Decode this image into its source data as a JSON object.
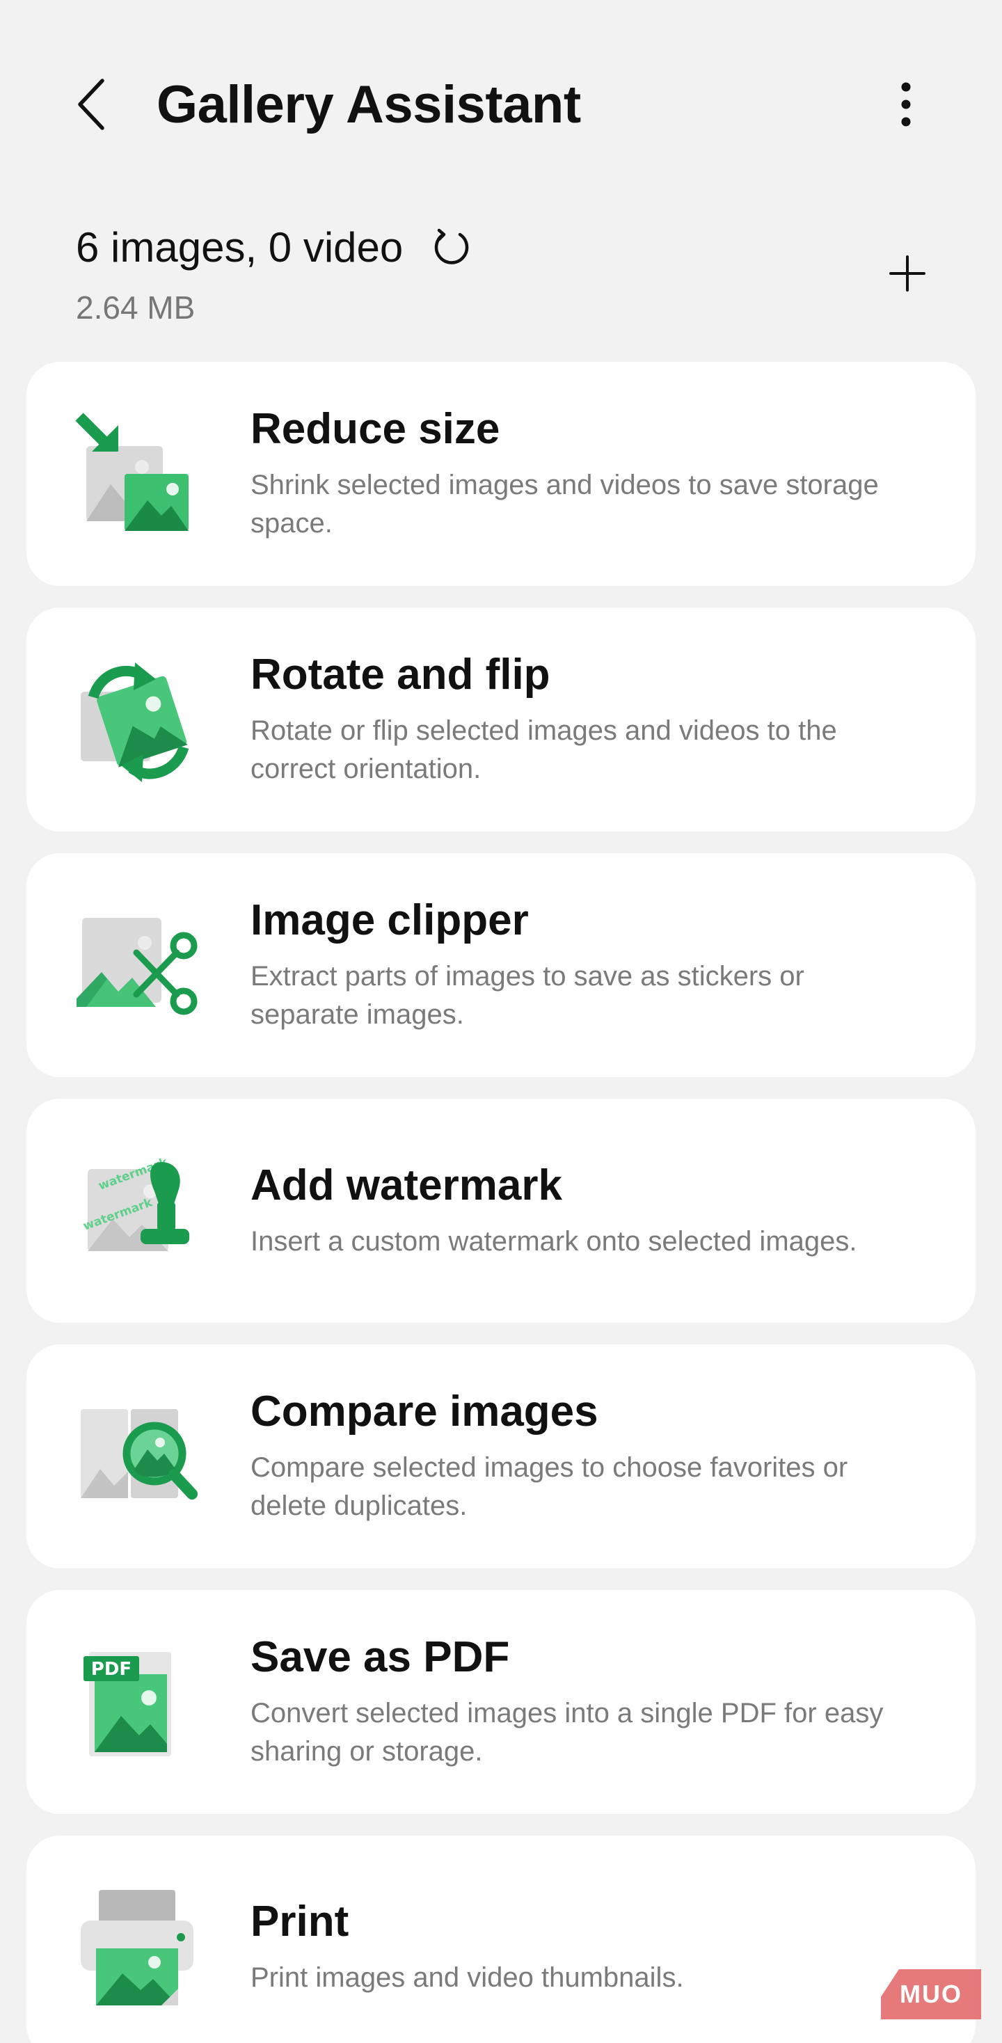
{
  "header": {
    "title": "Gallery Assistant",
    "back_icon": "chevron-left-icon",
    "more_icon": "more-vertical-icon"
  },
  "summary": {
    "count": "6 images, 0 video",
    "size": "2.64 MB",
    "refresh_icon": "refresh-icon",
    "add_icon": "plus-icon"
  },
  "colors": {
    "background": "#f2f2f2",
    "card": "#ffffff",
    "accent_green": "#1f9d55",
    "light_green": "#5fd08a",
    "muted_text": "#7a7a7a"
  },
  "tools": [
    {
      "title": "Reduce size",
      "description": "Shrink selected images and videos to save storage space.",
      "icon": "reduce-size-icon"
    },
    {
      "title": "Rotate and flip",
      "description": "Rotate or flip selected images and videos to the correct orientation.",
      "icon": "rotate-flip-icon"
    },
    {
      "title": "Image clipper",
      "description": "Extract parts of images to save as stickers or separate images.",
      "icon": "scissors-icon"
    },
    {
      "title": "Add watermark",
      "description": "Insert a custom watermark onto selected images.",
      "icon": "stamp-icon",
      "icon_text": "watermark"
    },
    {
      "title": "Compare images",
      "description": "Compare selected images to choose favorites or delete duplicates.",
      "icon": "magnifier-icon"
    },
    {
      "title": "Save as PDF",
      "description": "Convert selected images into a single PDF for easy sharing or storage.",
      "icon": "pdf-icon",
      "icon_text": "PDF"
    },
    {
      "title": "Print",
      "description": "Print images and video thumbnails.",
      "icon": "printer-icon"
    }
  ],
  "badge": {
    "label": "MUO"
  }
}
